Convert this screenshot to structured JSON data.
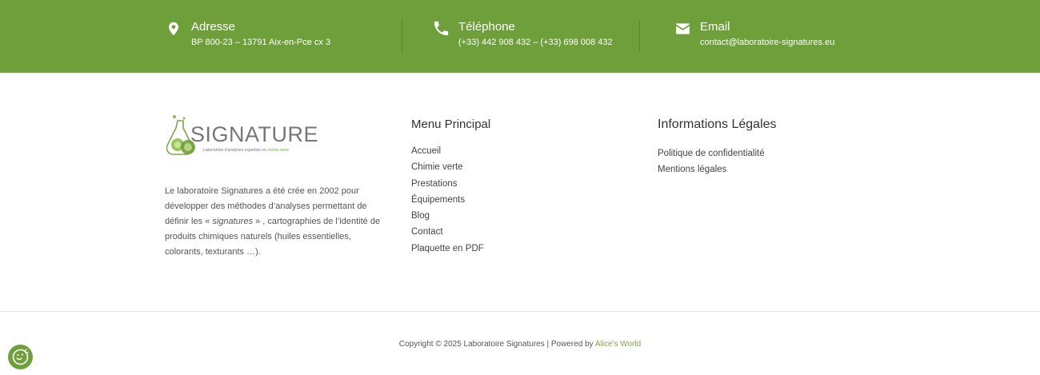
{
  "contact": {
    "address": {
      "title": "Adresse",
      "value": "BP 800-23 – 13791 Aix-en-Pce cx 3",
      "icon": "map-pin-icon"
    },
    "phone": {
      "title": "Téléphone",
      "value": "(+33) 442 908 432 – (+33) 698 008 432",
      "icon": "phone-icon"
    },
    "email": {
      "title": "Email",
      "value": "contact@laboratoire-signatures.eu",
      "icon": "envelope-icon"
    }
  },
  "logo": {
    "brand": "SIGNATURES",
    "tagline_prefix": "Laboratoire d'analyses expertise en ",
    "tagline_highlight": "chimie verte"
  },
  "about": {
    "text_part1": "Le laboratoire Signatures a été crée en 2002 pour développer des méthodes d’analyses permettant de définir les « ",
    "text_emphasis": "signatures",
    "text_part2": " » , cartographies de l’identité de produits chimiques naturels (huiles essentielles, colorants, texturants …)."
  },
  "menu_principal": {
    "title": "Menu Principal",
    "items": [
      "Accueil",
      "Chimie verte",
      "Prestations",
      "Équipements",
      "Blog",
      "Contact",
      "Plaquette en PDF"
    ]
  },
  "informations_legales": {
    "title": "Informations Légales",
    "items": [
      "Politique de confidentialité",
      "Mentions légales"
    ]
  },
  "copyright": {
    "text": "Copyright © 2025 Laboratoire Signatures | Powered by ",
    "link": "Alice's World"
  },
  "colors": {
    "brand_green": "#6f9f3b",
    "link_green": "#7ea446"
  },
  "cookie_button": {
    "icon": "cookie-icon"
  }
}
